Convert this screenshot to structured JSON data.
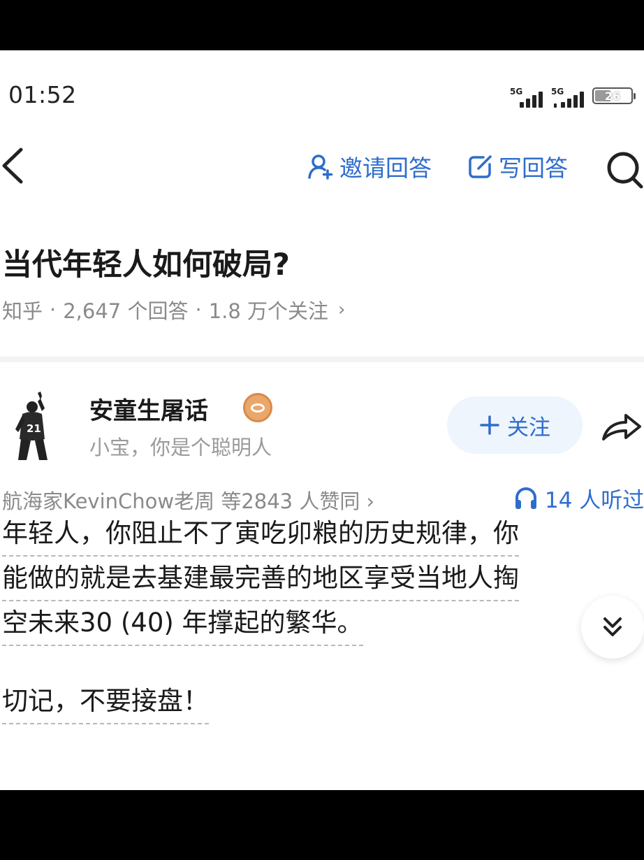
{
  "status_bar": {
    "time": "01:52",
    "signal1": "5G",
    "signal2": "5G",
    "battery": "26"
  },
  "nav": {
    "invite_label": "邀请回答",
    "write_label": "写回答",
    "icons": [
      "back-icon",
      "invite-user-icon",
      "edit-icon",
      "search-icon"
    ]
  },
  "question": {
    "title": "当代年轻人如何破局?",
    "source": "知乎",
    "answers": "2,647 个回答",
    "follows": "1.8 万个关注",
    "sep": "·",
    "chevron": "›"
  },
  "answer": {
    "author_name": "安童生屠话",
    "author_bio": "小宝，你是个聪明人",
    "follow_label": "关注",
    "agree_text": "航海家KevinChow老周 等2843 人赞同 ›",
    "listen_text": "14 人听过",
    "lines": [
      "年轻人，你阻止不了寅吃卯粮的历史规律，你",
      "能做的就是去基建最完善的地区享受当地人掏",
      "空未来30 (40) 年撑起的繁华。",
      "",
      "切记，不要接盘！"
    ]
  },
  "colors": {
    "accent": "#2f6dcc",
    "follow_bg": "#eef5fd",
    "meta_text": "#8a8a8a",
    "title_text": "#1a1a1a"
  }
}
